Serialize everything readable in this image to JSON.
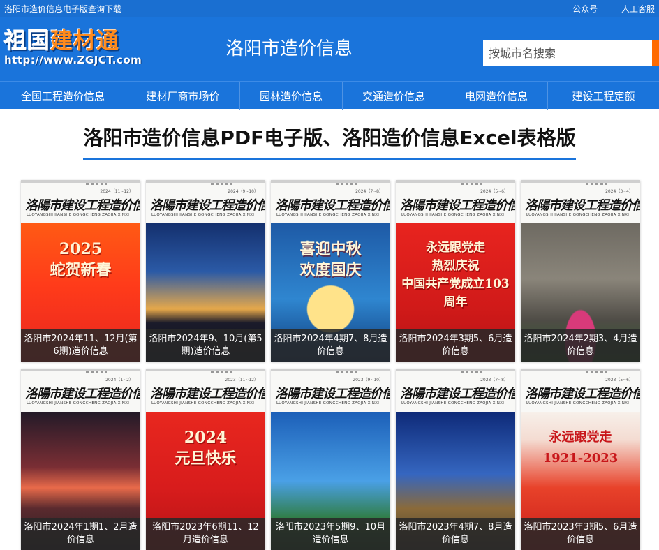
{
  "topbar": {
    "title": "洛阳市造价信息电子版查询下载",
    "links": [
      "公众号",
      "人工客服"
    ]
  },
  "header": {
    "logo_part1": "祖国",
    "logo_part2": "建材通",
    "logo_url": "http://www.ZGJCT.com",
    "city_title": "洛阳市造价信息",
    "search_placeholder": "按城市名搜索"
  },
  "nav": [
    "全国工程造价信息",
    "建材厂商市场价",
    "园林造价信息",
    "交通造价信息",
    "电网造价信息",
    "建设工程定额"
  ],
  "heading": "洛阳市造价信息PDF电子版、洛阳造价信息Excel表格版",
  "cover": {
    "magazine_title": "洛陽市建设工程造价信息",
    "magazine_pinyin": "LUOYANGSHI JIANSHE GONGCHENG ZAOJIA XINXI"
  },
  "cards": [
    {
      "caption": "洛阳市2024年11、12月(第6期)造价信息",
      "issue": "2024（11~12）",
      "art_text": "2025\n蛇贺新春",
      "theme": "red-orange"
    },
    {
      "caption": "洛阳市2024年9、10月(第5期)造价信息",
      "issue": "2024（9~10）",
      "art_text": "",
      "theme": "night-city"
    },
    {
      "caption": "洛阳市2024年4期7、8月造价信息",
      "issue": "2024（7~8）",
      "art_text": "喜迎中秋\n欢度国庆",
      "theme": "blue-moon"
    },
    {
      "caption": "洛阳市2024年3期5、6月造价信息",
      "issue": "2024（5~6）",
      "art_text": "永远跟党走\n热烈庆祝\n中国共产党成立103周年",
      "theme": "red"
    },
    {
      "caption": "洛阳市2024年2期3、4月造价信息",
      "issue": "2024（3~4）",
      "art_text": "",
      "theme": "buddha"
    },
    {
      "caption": "洛阳市2024年1期1、2月造价信息",
      "issue": "2024（1~2）",
      "art_text": "",
      "theme": "sunset-tower"
    },
    {
      "caption": "洛阳市2023年6期11、12月造价信息",
      "issue": "2023（11~12）",
      "art_text": "2024\n元旦快乐",
      "theme": "dragon"
    },
    {
      "caption": "洛阳市2023年5期9、10月造价信息",
      "issue": "2023（9~10）",
      "art_text": "",
      "theme": "pagoda"
    },
    {
      "caption": "洛阳市2023年4期7、8月造价信息",
      "issue": "2023（7~8）",
      "art_text": "",
      "theme": "palace"
    },
    {
      "caption": "洛阳市2023年3期5、6月造价信息",
      "issue": "2023（5~6）",
      "art_text": "永远跟党走\n1921-2023",
      "theme": "red-wave"
    }
  ],
  "colors": {
    "brand_blue": "#1a74db",
    "accent_orange": "#ff6a00"
  }
}
